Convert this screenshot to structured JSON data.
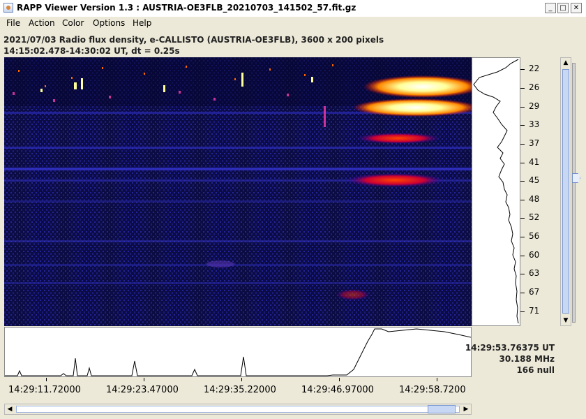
{
  "window": {
    "title": "RAPP Viewer Version 1.3 : AUSTRIA-OE3FLB_20210703_141502_57.fit.gz",
    "controls": {
      "minimize": "_",
      "maximize": "□",
      "close": "✕"
    }
  },
  "menu": {
    "items": [
      "File",
      "Action",
      "Color",
      "Options",
      "Help"
    ]
  },
  "header": {
    "line1": "2021/07/03  Radio flux density, e-CALLISTO (AUSTRIA-OE3FLB),  3600 x 200 pixels",
    "line2": "14:15:02.478-14:30:02 UT,  dt = 0.25s"
  },
  "frequency_axis": {
    "unit": "MHz",
    "labels": [
      "22",
      "26",
      "29",
      "33",
      "37",
      "41",
      "45",
      "48",
      "52",
      "56",
      "60",
      "63",
      "67",
      "71"
    ]
  },
  "time_axis": {
    "labels": [
      "14:29:11.72000",
      "14:29:23.47000",
      "14:29:35.22000",
      "14:29:46.97000",
      "14:29:58.7200"
    ]
  },
  "readout": {
    "time": "14:29:53.76375 UT",
    "frequency": "30.188 MHz",
    "value": "166 null"
  },
  "colors": {
    "background": "#ece9d8",
    "spectrogram_bg": "#0a0a3a",
    "burst": "#ffffcc"
  }
}
